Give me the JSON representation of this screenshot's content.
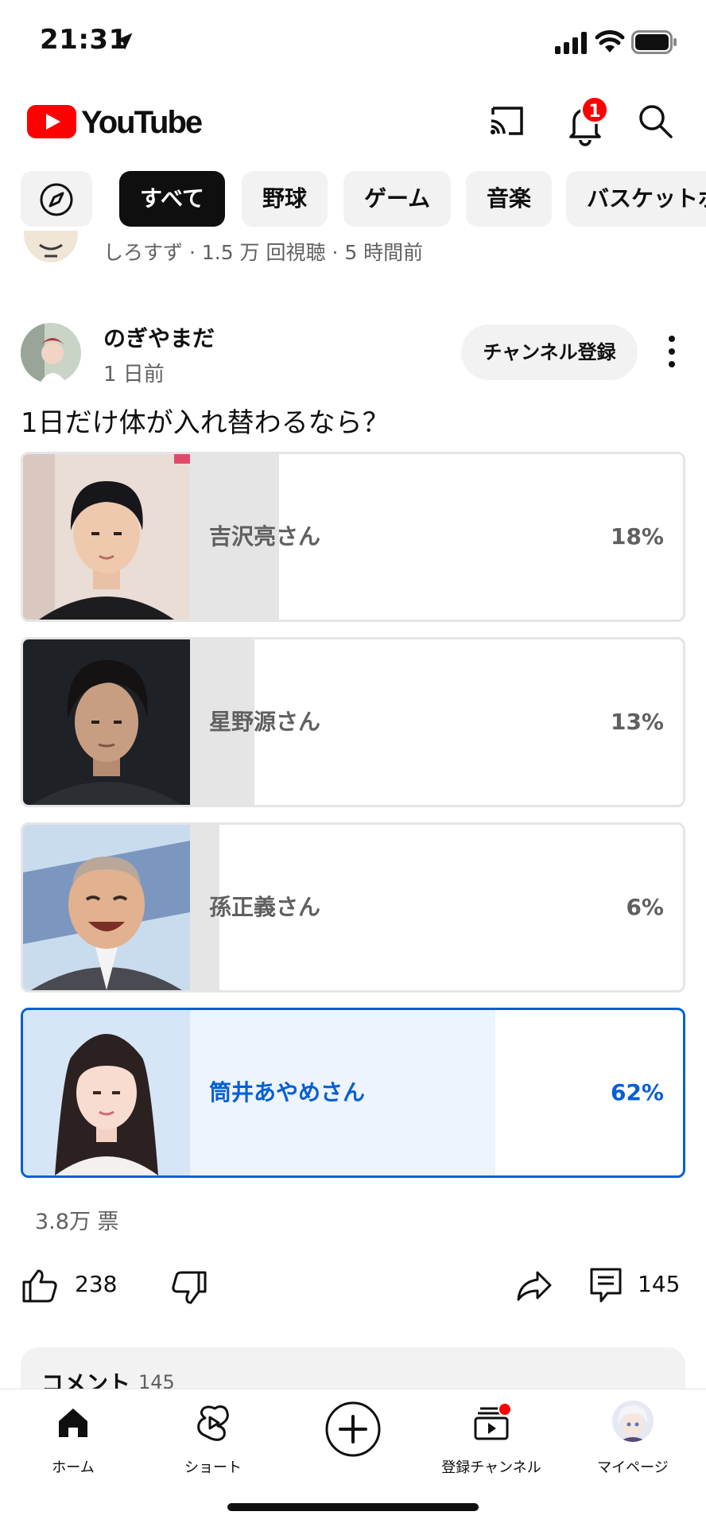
{
  "status_bar": {
    "time": "21:31"
  },
  "header": {
    "logo_text": "YouTube",
    "notification_badge": "1"
  },
  "chips": [
    "すべて",
    "野球",
    "ゲーム",
    "音楽",
    "バスケットボ"
  ],
  "previous_item": {
    "meta": "しろすず · 1.5 万 回視聴 · 5 時間前"
  },
  "post": {
    "author": "のぎやまだ",
    "time": "1 日前",
    "subscribe_label": "チャンネル登録",
    "text": "1日だけ体が入れ替わるなら？",
    "poll": [
      {
        "label": "吉沢亮さん",
        "percent_text": "18%",
        "percent": 18,
        "selected": false
      },
      {
        "label": "星野源さん",
        "percent_text": "13%",
        "percent": 13,
        "selected": false
      },
      {
        "label": "孫正義さん",
        "percent_text": "6%",
        "percent": 6,
        "selected": false
      },
      {
        "label": "筒井あやめさん",
        "percent_text": "62%",
        "percent": 62,
        "selected": true
      }
    ],
    "votes": "3.8万 票",
    "likes": "238",
    "comments": "145"
  },
  "comments_card": {
    "title": "コメント",
    "count": "145"
  },
  "bottom_nav": [
    {
      "label": "ホーム",
      "icon": "home-icon"
    },
    {
      "label": "ショート",
      "icon": "shorts-icon"
    },
    {
      "label": "",
      "icon": "create-icon"
    },
    {
      "label": "登録チャンネル",
      "icon": "subscriptions-icon"
    },
    {
      "label": "マイページ",
      "icon": "avatar"
    }
  ],
  "colors": {
    "accent": "#065fd4",
    "brand_red": "#ff0000",
    "selected_bar": "#eef4fd",
    "bar": "#e5e5e5"
  }
}
